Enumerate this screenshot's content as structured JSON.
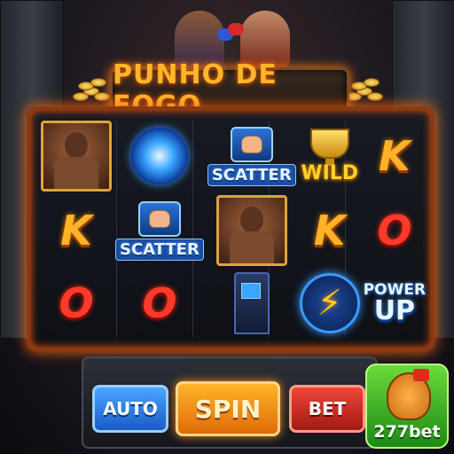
{
  "game": {
    "title": "PUNHO DE FOGO",
    "reels": [
      [
        {
          "type": "fighter",
          "icon": "fighter-portrait-icon"
        },
        {
          "type": "letter",
          "text": "K",
          "color": "#ffb327"
        },
        {
          "type": "letter",
          "text": "O",
          "color": "#ff3a2a"
        }
      ],
      [
        {
          "type": "vortex",
          "icon": "blue-vortex-icon"
        },
        {
          "type": "scatter",
          "text": "SCATTER",
          "icon": "fist-icon"
        },
        {
          "type": "letter",
          "text": "O",
          "color": "#ff3a2a"
        }
      ],
      [
        {
          "type": "scatter",
          "text": "SCATTER",
          "icon": "fist-icon"
        },
        {
          "type": "fighter",
          "icon": "fighter-portrait-icon"
        },
        {
          "type": "arcade",
          "icon": "arcade-cabinet-icon"
        }
      ],
      [
        {
          "type": "wild",
          "text": "WILD",
          "icon": "trophy-icon"
        },
        {
          "type": "letter",
          "text": "K",
          "color": "#ffb327"
        },
        {
          "type": "bolt",
          "icon": "lightning-bolt-icon"
        }
      ],
      [
        {
          "type": "letter",
          "text": "K",
          "color": "#ffb327"
        },
        {
          "type": "letter",
          "text": "O",
          "color": "#ff3a2a"
        },
        {
          "type": "powerup",
          "text_top": "POWER",
          "text_bottom": "UP"
        }
      ]
    ]
  },
  "controls": {
    "auto_label": "AUTO",
    "spin_label": "SPIN",
    "bet_label": "BET"
  },
  "brand": {
    "text": "277bet"
  },
  "colors": {
    "accent_orange": "#ff7a1a",
    "spin_button": "#e06a08",
    "auto_button": "#1a5ac8",
    "bet_button": "#a01a12"
  }
}
